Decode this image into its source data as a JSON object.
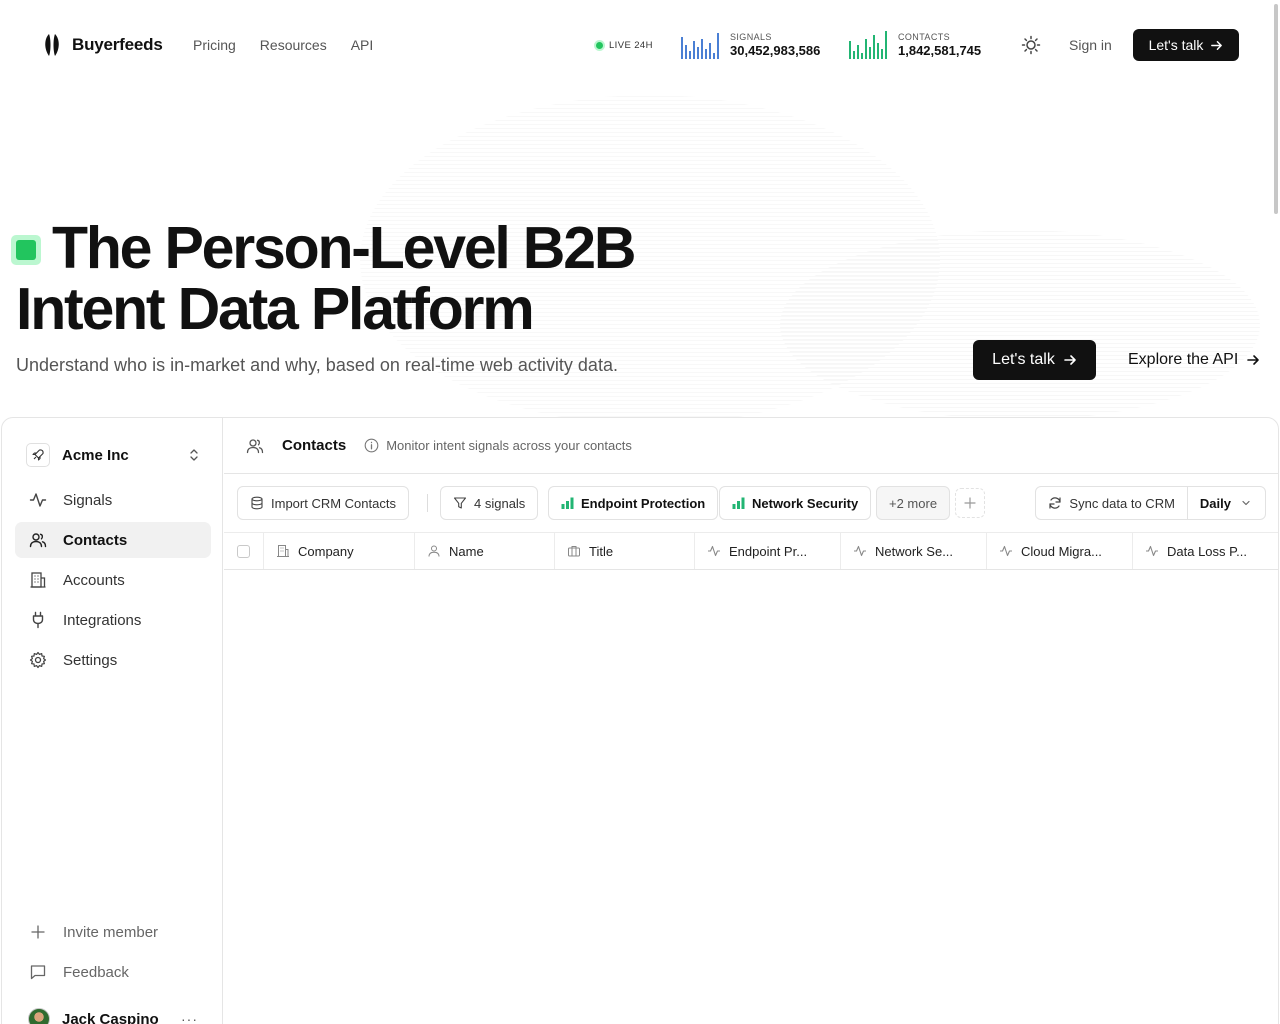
{
  "brand": {
    "name": "Buyerfeeds"
  },
  "nav": {
    "items": [
      "Pricing",
      "Resources",
      "API"
    ]
  },
  "live": {
    "label": "LIVE 24H"
  },
  "stats": [
    {
      "label": "SIGNALS",
      "value": "30,452,983,586",
      "color": "#4a7fd4"
    },
    {
      "label": "CONTACTS",
      "value": "1,842,581,745",
      "color": "#22b573"
    }
  ],
  "header": {
    "signin_label": "Sign in",
    "cta_label": "Let's talk"
  },
  "hero": {
    "title_line1": "The Person-Level B2B",
    "title_line2": "Intent Data Platform",
    "subtitle": "Understand who is in-market and why, based on real-time web activity data.",
    "cta_label": "Let's talk",
    "secondary_label": "Explore the API",
    "badge_color": "#22c55e"
  },
  "sidebar": {
    "org_name": "Acme Inc",
    "items": [
      {
        "label": "Signals",
        "icon": "activity-icon"
      },
      {
        "label": "Contacts",
        "icon": "users-icon",
        "active": true
      },
      {
        "label": "Accounts",
        "icon": "building-icon"
      },
      {
        "label": "Integrations",
        "icon": "plug-icon"
      },
      {
        "label": "Settings",
        "icon": "gear-icon"
      }
    ],
    "invite_label": "Invite member",
    "feedback_label": "Feedback",
    "user_name": "Jack Caspino"
  },
  "main": {
    "title": "Contacts",
    "info": "Monitor intent signals across your contacts",
    "toolbar": {
      "import_label": "Import CRM Contacts",
      "signals_label": "4 signals",
      "filters": [
        "Endpoint Protection",
        "Network Security"
      ],
      "more_label": "+2 more",
      "sync_label": "Sync data to CRM",
      "frequency": "Daily"
    },
    "columns": [
      "Company",
      "Name",
      "Title",
      "Endpoint Pr...",
      "Network Se...",
      "Cloud Migra...",
      "Data Loss P..."
    ]
  }
}
